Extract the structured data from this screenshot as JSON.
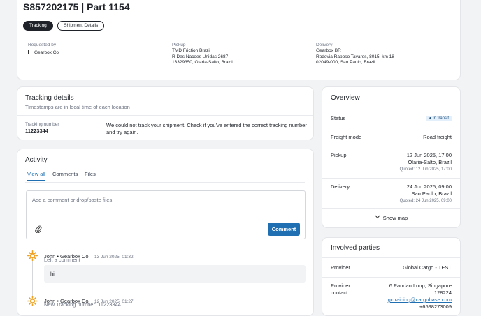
{
  "header": {
    "title": "S857202175 | Part 1154",
    "tabs": [
      "Tracking",
      "Shipment Details"
    ],
    "requested_by_label": "Requested by",
    "requested_by": "Gearbox Co",
    "pickup_label": "Pickup",
    "pickup_lines": [
      "TMD Friction Brazil",
      "R Das Nacoes Unidas 2687",
      "13329350, Olaria-Salto, Brazil"
    ],
    "delivery_label": "Delivery",
    "delivery_lines": [
      "Gearbox BR",
      "Rodovia Raposo Tavares, 8015, km 18",
      "02049-000, Sao Paulo, Brazil"
    ]
  },
  "tracking": {
    "title": "Tracking details",
    "subtitle": "Timestamps are in local time of each location",
    "number_label": "Tracking number",
    "number": "11223344",
    "message": "We could not track your shipment. Check if you've entered the correct tracking number and try again."
  },
  "activity": {
    "title": "Activity",
    "tabs": [
      "View all",
      "Comments",
      "Files"
    ],
    "comment_placeholder": "Add a comment or drop/paste files.",
    "comment_button": "Comment",
    "entries": [
      {
        "author": "John • Gearbox Co",
        "time": "13 Jun 2025, 01:32",
        "action": "Left a comment",
        "body": "hi"
      },
      {
        "author": "John • Gearbox Co",
        "time": "12 Jun 2025, 01:27",
        "action": "New Tracking number: 11223344",
        "body": ""
      }
    ]
  },
  "overview": {
    "title": "Overview",
    "status_label": "Status",
    "status": "In transit",
    "freight_label": "Freight mode",
    "freight": "Road freight",
    "pickup_label": "Pickup",
    "pickup_date": "12 Jun 2025, 17:00",
    "pickup_place": "Olaria-Salto, Brazil",
    "pickup_quoted": "Quoted: 12 Jun 2025, 17:00",
    "delivery_label": "Delivery",
    "delivery_date": "24 Jun 2025, 09:00",
    "delivery_place": "Sao Paulo, Brazil",
    "delivery_quoted": "Quoted: 24 Jun 2025, 09:00",
    "show_map": "Show map"
  },
  "parties": {
    "title": "Involved parties",
    "provider_label": "Provider",
    "provider": "Global Cargo - TEST",
    "contact_label_1": "Provider",
    "contact_label_2": "contact",
    "contact_lines": [
      "6 Pandan Loop, Singapore",
      "128224"
    ],
    "contact_email": "gctraining@cargobase.com",
    "contact_phone": "+6598273009"
  },
  "colors": {
    "accent": "#1f6fb2",
    "status_bg": "#e3effb",
    "sun": "#f0a020"
  }
}
